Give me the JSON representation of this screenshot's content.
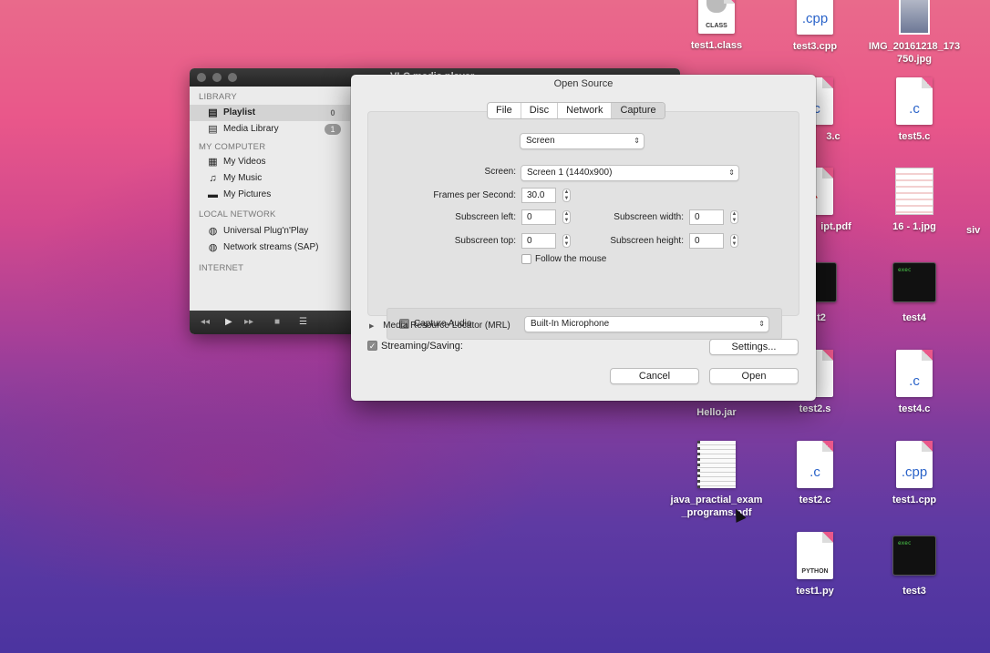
{
  "desktop": {
    "icons": [
      {
        "label": "test1.class",
        "tag": "CLASS"
      },
      {
        "label": "test3.cpp",
        "ext": ".cpp"
      },
      {
        "label": "IMG_20161218_173\n750.jpg"
      },
      {
        "label": "test3.c",
        "partial": "3.c"
      },
      {
        "label": "test5.c",
        "ext": ".c"
      },
      {
        "label": "script.pdf",
        "partial": "ipt.pdf"
      },
      {
        "label": "16 - 1.jpg"
      },
      {
        "label": "test2",
        "partial": "t2"
      },
      {
        "label": "test4",
        "tag": "exec"
      },
      {
        "label": "Hello.jar"
      },
      {
        "label": "test2.s"
      },
      {
        "label": "test4.c",
        "ext": ".c"
      },
      {
        "label": "java_practial_exam\n_programs.pdf"
      },
      {
        "label": "test2.c",
        "ext": ".c"
      },
      {
        "label": "test1.cpp",
        "ext": ".cpp"
      },
      {
        "label": "test1.py",
        "tag": "PYTHON"
      },
      {
        "label": "test3",
        "tag": "exec"
      },
      {
        "label": "siv",
        "partial": "siv"
      }
    ]
  },
  "vlc": {
    "title": "VLC media player",
    "sidebar": {
      "sections": [
        {
          "header": "LIBRARY",
          "items": [
            {
              "label": "Playlist",
              "icon": "playlist-icon",
              "count": "0"
            },
            {
              "label": "Media Library",
              "icon": "media-library-icon",
              "count": "1"
            }
          ]
        },
        {
          "header": "MY COMPUTER",
          "items": [
            {
              "label": "My Videos",
              "icon": "film-icon"
            },
            {
              "label": "My Music",
              "icon": "music-note-icon"
            },
            {
              "label": "My Pictures",
              "icon": "picture-icon"
            }
          ]
        },
        {
          "header": "LOCAL NETWORK",
          "items": [
            {
              "label": "Universal Plug'n'Play",
              "icon": "globe-icon"
            },
            {
              "label": "Network streams (SAP)",
              "icon": "globe-icon"
            }
          ]
        },
        {
          "header": "INTERNET",
          "items": []
        }
      ]
    },
    "controls": [
      "rewind-icon",
      "play-icon",
      "fast-forward-icon",
      "stop-icon",
      "playlist-toggle-icon"
    ]
  },
  "dialog": {
    "title": "Open Source",
    "tabs": [
      "File",
      "Disc",
      "Network",
      "Capture"
    ],
    "active_tab": "Capture",
    "capture_type": "Screen",
    "screen_label": "Screen:",
    "screen_value": "Screen 1 (1440x900)",
    "fps_label": "Frames per Second:",
    "fps_value": "30.0",
    "left_label": "Subscreen left:",
    "left_value": "0",
    "width_label": "Subscreen width:",
    "width_value": "0",
    "top_label": "Subscreen top:",
    "top_value": "0",
    "height_label": "Subscreen height:",
    "height_value": "0",
    "follow_mouse_label": "Follow the mouse",
    "follow_mouse_checked": false,
    "capture_audio_label": "Capture Audio",
    "capture_audio_checked": true,
    "audio_device": "Built-In Microphone",
    "mrl_label": "Media Resource Locator (MRL)",
    "streaming_label": "Streaming/Saving:",
    "streaming_checked": true,
    "settings_button": "Settings...",
    "cancel_button": "Cancel",
    "open_button": "Open"
  }
}
